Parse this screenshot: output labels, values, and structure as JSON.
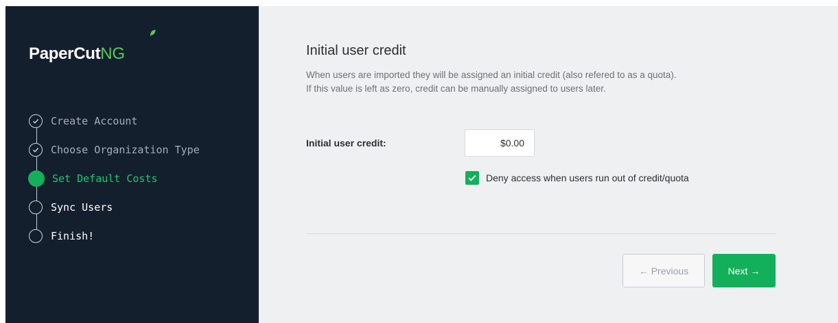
{
  "brand": {
    "name_primary": "PaperCut",
    "name_suffix": "NG",
    "accent": "#12b05a",
    "sidebar_bg": "#141f2e"
  },
  "steps": [
    {
      "label": "Create Account",
      "status": "completed",
      "icon": "check-circle-icon"
    },
    {
      "label": "Choose Organization Type",
      "status": "completed",
      "icon": "check-circle-icon"
    },
    {
      "label": "Set Default Costs",
      "status": "active",
      "icon": "filled-circle-icon"
    },
    {
      "label": "Sync Users",
      "status": "upcoming",
      "icon": "empty-circle-icon"
    },
    {
      "label": "Finish!",
      "status": "upcoming",
      "icon": "empty-circle-icon"
    }
  ],
  "main": {
    "title": "Initial user credit",
    "desc_line1": "When users are imported they will be assigned an initial credit (also refered to as a quota).",
    "desc_line2": "If this value is left as zero, credit can be manually assigned to users later.",
    "credit_label": "Initial user credit:",
    "credit_value": "$0.00",
    "deny_access_label": "Deny access when users run out of credit/quota",
    "deny_access_checked": true
  },
  "nav": {
    "previous_label": "← Previous",
    "next_label": "Next →"
  }
}
